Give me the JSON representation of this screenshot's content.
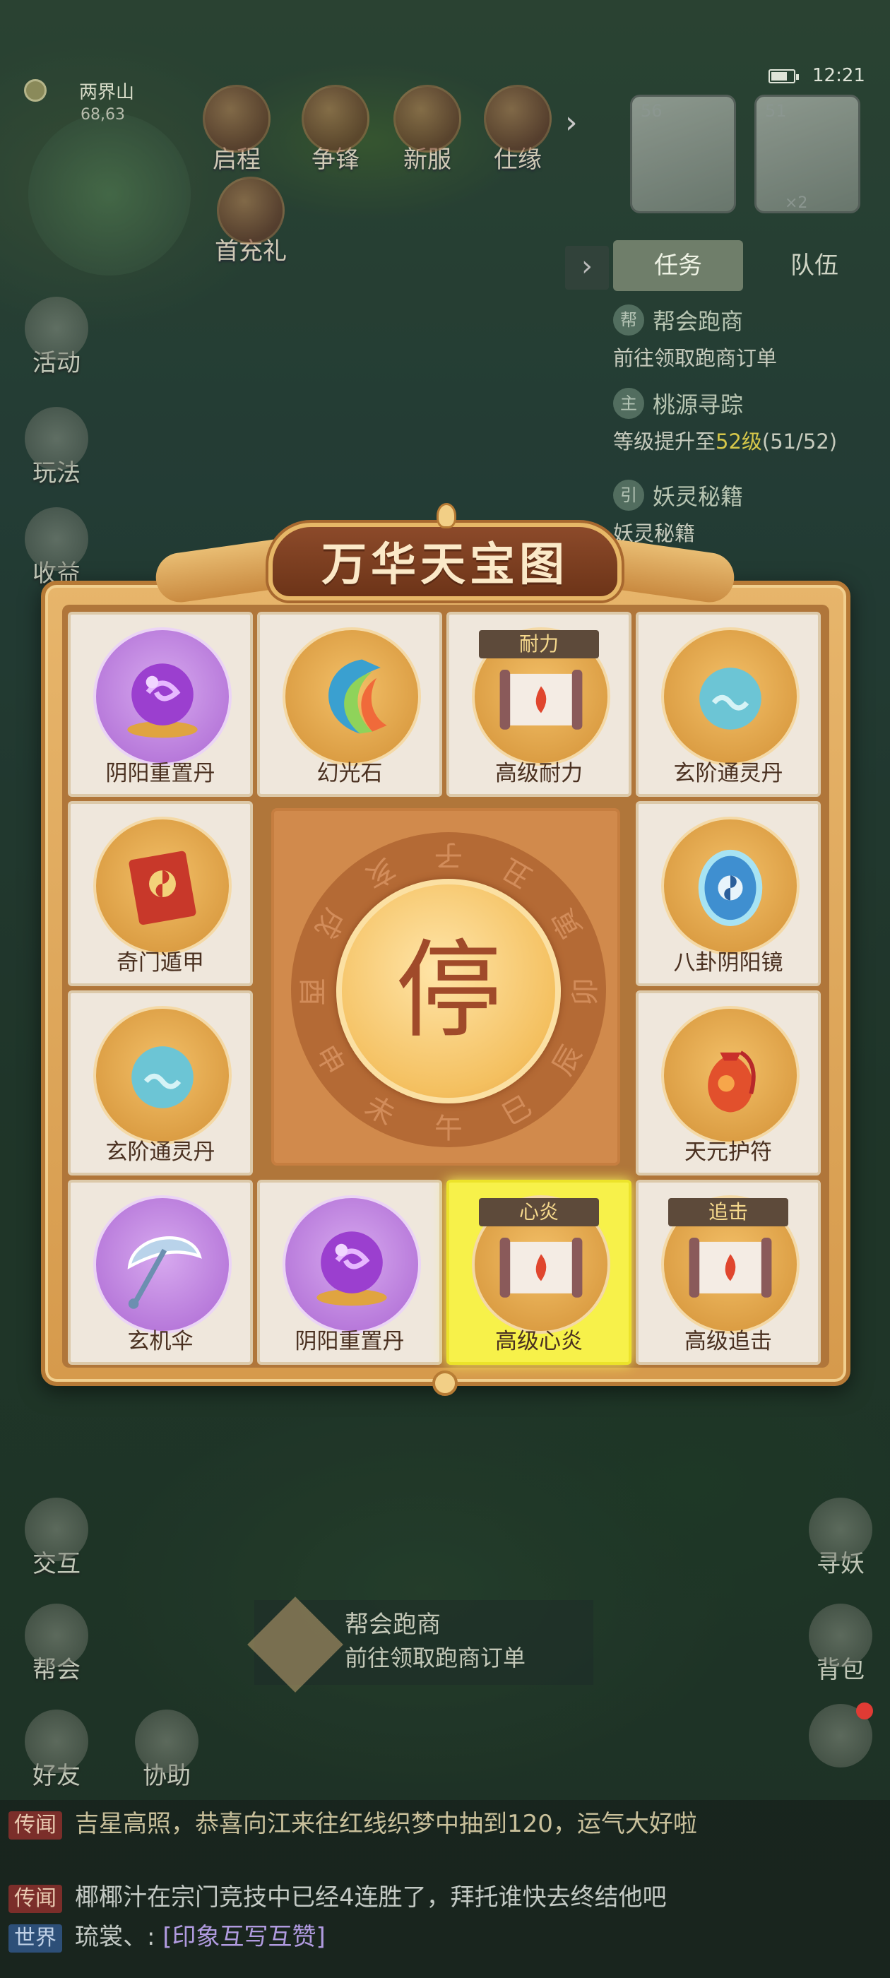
{
  "status": {
    "time": "12:21"
  },
  "location": {
    "name": "两界山",
    "coords": "68,63"
  },
  "top_buttons": [
    "启程",
    "争锋",
    "新服",
    "仕缘",
    "首充礼"
  ],
  "party": [
    {
      "level": "56"
    },
    {
      "level": "51",
      "extra": "×2"
    }
  ],
  "side_tabs": {
    "task": "任务",
    "team": "队伍"
  },
  "quests": [
    {
      "badge": "帮",
      "title": "帮会跑商",
      "desc": "前往领取跑商订单"
    },
    {
      "badge": "主",
      "title": "桃源寻踪",
      "desc_prefix": "等级提升至",
      "desc_level": "52级",
      "desc_progress": "(51/52)"
    },
    {
      "badge": "引",
      "title": "妖灵秘籍",
      "desc": "妖灵秘籍"
    }
  ],
  "left_buttons": [
    "活动",
    "玩法",
    "收益",
    "交互",
    "帮会",
    "好友",
    "协助"
  ],
  "right_buttons": [
    "寻妖",
    "背包"
  ],
  "nav_tracker": {
    "title": "帮会跑商",
    "desc": "前往领取跑商订单"
  },
  "chat": [
    {
      "tag": "传闻",
      "text": "吉星高照，恭喜向江来往红线织梦中抽到120",
      "tail": "，运气大好啦"
    },
    {
      "tag": "传闻",
      "text": "椰椰汁在宗门竞技中已经4连胜了，拜托谁快去终结他吧"
    },
    {
      "tag": "世界",
      "speaker": "琉裳、:",
      "text": "[印象互写互赞]"
    }
  ],
  "treasure": {
    "title": "万华天宝图",
    "center_label": "停",
    "zodiac": [
      "子",
      "丑",
      "寅",
      "卯",
      "辰",
      "巳",
      "午",
      "未",
      "申",
      "酉",
      "戌",
      "亥"
    ],
    "items": [
      {
        "name": "阴阳重置丹",
        "tag": ""
      },
      {
        "name": "幻光石",
        "tag": ""
      },
      {
        "name": "高级耐力",
        "tag": "耐力"
      },
      {
        "name": "玄阶通灵丹",
        "tag": ""
      },
      {
        "name": "奇门遁甲",
        "tag": ""
      },
      {
        "name": "八卦阴阳镜",
        "tag": ""
      },
      {
        "name": "玄阶通灵丹",
        "tag": ""
      },
      {
        "name": "天元护符",
        "tag": ""
      },
      {
        "name": "玄机伞",
        "tag": ""
      },
      {
        "name": "阴阳重置丹",
        "tag": ""
      },
      {
        "name": "高级心炎",
        "tag": "心炎",
        "selected": true
      },
      {
        "name": "高级追击",
        "tag": "追击"
      }
    ]
  }
}
